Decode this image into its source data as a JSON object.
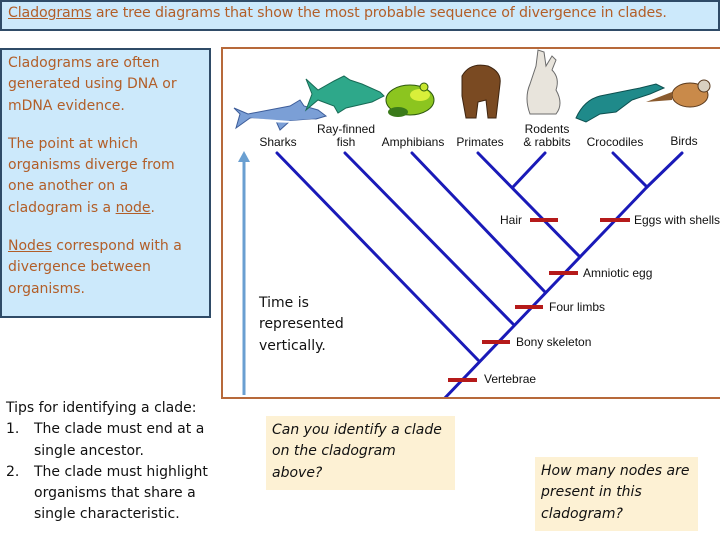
{
  "title": {
    "underlined_term": "Cladograms",
    "rest": " are tree diagrams that show the most probable sequence of divergence in clades."
  },
  "info_box": {
    "para1": "Cladograms are often generated using DNA or mDNA evidence.",
    "para2_before": "The point at which organisms diverge from one another on a cladogram is a ",
    "para2_term": "node",
    "para2_after": ".",
    "para3_term": "Nodes",
    "para3_after": " correspond with a divergence between organisms."
  },
  "tips": {
    "heading": "Tips for identifying a clade:",
    "items": [
      {
        "num": "1.",
        "text": "The clade must end at a single ancestor."
      },
      {
        "num": "2.",
        "text": "The clade must highlight organisms that share a single characteristic."
      }
    ]
  },
  "time_note": "Time is represented vertically.",
  "questions": {
    "q1": "Can you identify a clade on the cladogram above?",
    "q2": "How many nodes are present in this cladogram?"
  },
  "cladogram": {
    "taxa": [
      {
        "line1": "",
        "line2": "Sharks",
        "icon": "shark-icon"
      },
      {
        "line1": "Ray-finned",
        "line2": "fish",
        "icon": "fish-icon"
      },
      {
        "line1": "",
        "line2": "Amphibians",
        "icon": "frog-icon"
      },
      {
        "line1": "",
        "line2": "Primates",
        "icon": "primate-icon"
      },
      {
        "line1": "Rodents",
        "line2": "& rabbits",
        "icon": "rabbit-icon"
      },
      {
        "line1": "",
        "line2": "Crocodiles",
        "icon": "crocodile-icon"
      },
      {
        "line1": "",
        "line2": "Birds",
        "icon": "bird-icon"
      }
    ],
    "traits": {
      "hair": "Hair",
      "eggs": "Eggs with shells",
      "amniotic": "Amniotic egg",
      "limbs": "Four limbs",
      "bony": "Bony skeleton",
      "vertebrae": "Vertebrae"
    },
    "colors": {
      "branch": "#1a1ab8",
      "trait_mark": "#b51a1a",
      "time_arrow": "#6a9fd1",
      "frame": "#b7693a"
    }
  }
}
